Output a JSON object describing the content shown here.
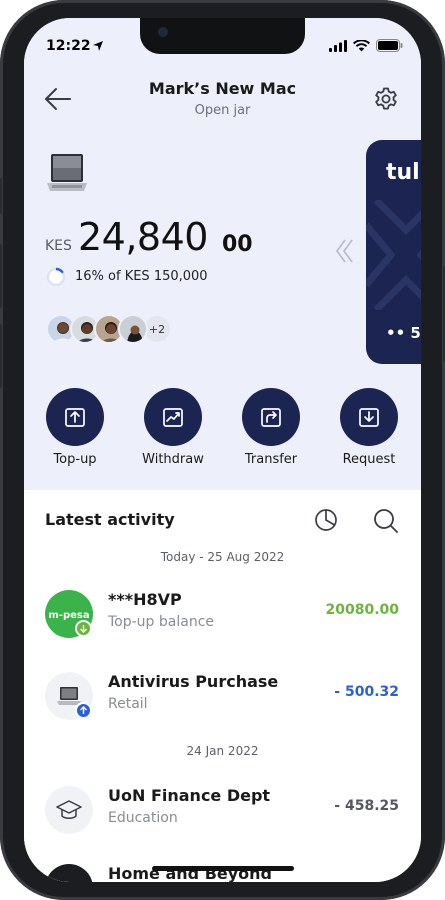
{
  "status_bar": {
    "time": "12:22"
  },
  "header": {
    "title": "Mark’s New Mac",
    "subtitle": "Open jar"
  },
  "balance": {
    "currency": "KES",
    "amount": "24,840",
    "cents": "00",
    "progress_text": "16% of KES 150,000",
    "progress_fraction": 0.16
  },
  "card": {
    "brand": "tul",
    "masked_number": "•• 5"
  },
  "members": {
    "extra_count": "+2"
  },
  "actions": [
    {
      "label": "Top-up",
      "icon": "upload-icon"
    },
    {
      "label": "Withdraw",
      "icon": "chart-icon"
    },
    {
      "label": "Transfer",
      "icon": "transfer-icon"
    },
    {
      "label": "Request",
      "icon": "download-icon"
    }
  ],
  "activity": {
    "title": "Latest activity",
    "groups": [
      {
        "date": "Today - 25 Aug 2022",
        "items": [
          {
            "name": "***H8VP",
            "category": "Top-up balance",
            "amount": "20080.00",
            "color": "#6cb33f",
            "logo": "m-pesa",
            "badge": "down"
          },
          {
            "name": "Antivirus Purchase",
            "category": "Retail",
            "amount": "- 500.32",
            "color": "#2a5fd9",
            "logo": "laptop",
            "badge": "up"
          }
        ]
      },
      {
        "date": "24 Jan 2022",
        "items": [
          {
            "name": "UoN Finance Dept",
            "category": "Education",
            "amount": "- 458.25",
            "color": "#555861",
            "logo": "graduation"
          },
          {
            "name": "Home and Beyond",
            "category": "",
            "amount": "",
            "color": "#555861",
            "logo": "home"
          }
        ]
      }
    ]
  },
  "colors": {
    "navy": "#1c2552",
    "header_bg": "#edf0fa",
    "mpesa_green": "#3ab44a",
    "positive": "#6cb33f",
    "negative_blue": "#2a5fd9"
  }
}
